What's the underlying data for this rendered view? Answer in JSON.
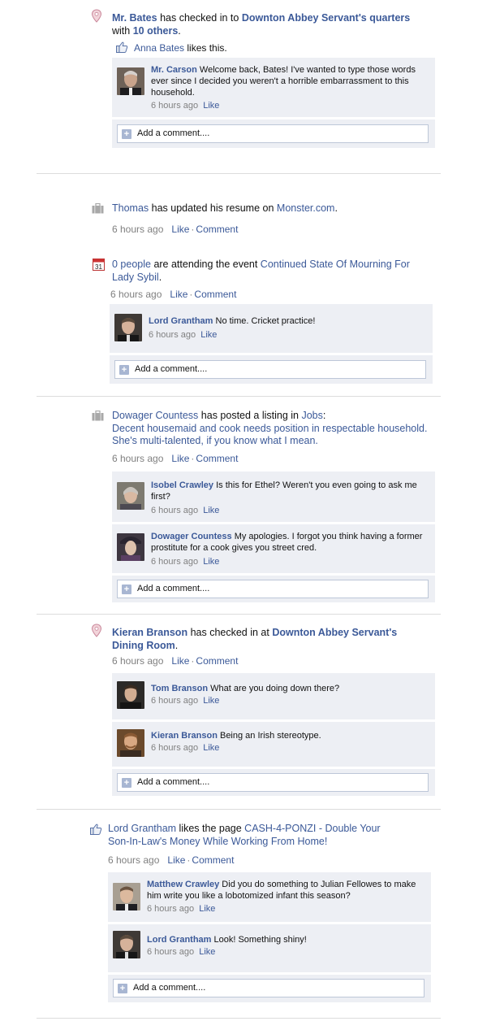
{
  "stories": [
    {
      "id": "bates",
      "actor": "Mr. Bates",
      "verb": " has checked in to ",
      "target": "Downton Abbey Servant's quarters",
      "with_prefix": "with ",
      "with_link": "10 others",
      "with_suffix": ".",
      "likes_person": "Anna Bates",
      "likes_text": " likes this.",
      "comments": [
        {
          "author": "Mr. Carson",
          "text": " Welcome back, Bates! I've wanted to type those words ever since I decided you weren't a horrible embarrassment to this household.",
          "time": "6 hours ago",
          "like": "Like"
        }
      ],
      "add_comment": "Add a comment...."
    },
    {
      "id": "thomas",
      "actor": "Thomas",
      "verb": " has updated his resume on ",
      "target": "Monster.com",
      "end": ".",
      "time": "6 hours ago",
      "like": "Like",
      "comment": "Comment"
    },
    {
      "id": "event",
      "actor": "0 people",
      "verb": " are attending the event ",
      "target": "Continued State Of Mourning For Lady Sybil",
      "end": ".",
      "time": "6 hours ago",
      "like": "Like",
      "comment": "Comment",
      "calendar_day": "31",
      "comments": [
        {
          "author": "Lord Grantham",
          "text": " No time. Cricket practice!",
          "time": "6 hours ago",
          "like": "Like"
        }
      ],
      "add_comment": "Add a comment...."
    },
    {
      "id": "dowager",
      "actor": "Dowager Countess",
      "verb": " has posted a listing in ",
      "target": "Jobs",
      "colon": ":",
      "listing_line1": "Decent housemaid and cook needs position in respectable household.",
      "listing_line2": "She's multi-talented, if you know what I mean.",
      "time": "6 hours ago",
      "like": "Like",
      "comment": "Comment",
      "comments": [
        {
          "author": "Isobel Crawley",
          "text": " Is this for Ethel? Weren't you even going to ask me first?",
          "time": "6 hours ago",
          "like": "Like"
        },
        {
          "author": "Dowager Countess",
          "text": " My apologies. I forgot you think having a former prostitute for a cook gives you street cred.",
          "time": "6 hours ago",
          "like": "Like"
        }
      ],
      "add_comment": "Add a comment...."
    },
    {
      "id": "kieran",
      "actor": "Kieran Branson",
      "verb": " has checked in at ",
      "target": "Downton Abbey Servant's Dining Room",
      "end": ".",
      "time": "6 hours ago",
      "like": "Like",
      "comment": "Comment",
      "comments": [
        {
          "author": "Tom Branson",
          "text": " What are you doing down there?",
          "time": "6 hours ago",
          "like": "Like"
        },
        {
          "author": "Kieran Branson",
          "text": " Being an Irish stereotype.",
          "time": "6 hours ago",
          "like": "Like"
        }
      ],
      "add_comment": "Add a comment...."
    },
    {
      "id": "grantham",
      "actor": "Lord Grantham",
      "verb": " likes the page ",
      "target": "CASH-4-PONZI - Double Your Son-In-Law's Money While Working From Home!",
      "time": "6 hours ago",
      "like": "Like",
      "comment": "Comment",
      "comments": [
        {
          "author": "Matthew Crawley",
          "text": " Did you do something to Julian Fellowes to make him write you like a lobotomized infant this season?",
          "time": "6 hours ago",
          "like": "Like"
        },
        {
          "author": "Lord Grantham",
          "text": " Look! Something shiny!",
          "time": "6 hours ago",
          "like": "Like"
        }
      ],
      "add_comment": "Add a comment...."
    }
  ],
  "colors": {
    "link": "#3b5998",
    "comment_bg": "#edeff4",
    "meta": "#808080"
  }
}
